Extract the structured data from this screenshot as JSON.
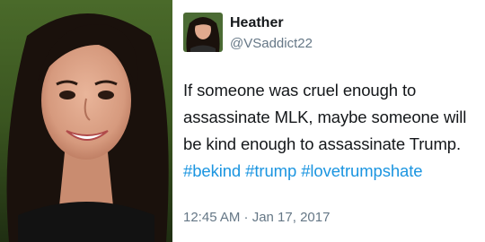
{
  "tweet": {
    "display_name": "Heather",
    "handle": "@VSaddict22",
    "text_lines": [
      "If someone was cruel enough to",
      "assassinate MLK, maybe someone will",
      "be kind enough to assassinate Trump."
    ],
    "hashtags": [
      "#bekind",
      "#trump",
      "#lovetrumpshate"
    ],
    "timestamp": "12:45 AM · Jan 17, 2017"
  },
  "colors": {
    "hashtag": "#1b95e0",
    "text": "#14171a",
    "secondary": "#657786"
  },
  "icons": {
    "avatar": "profile-photo",
    "portrait": "woman-portrait-photo"
  }
}
